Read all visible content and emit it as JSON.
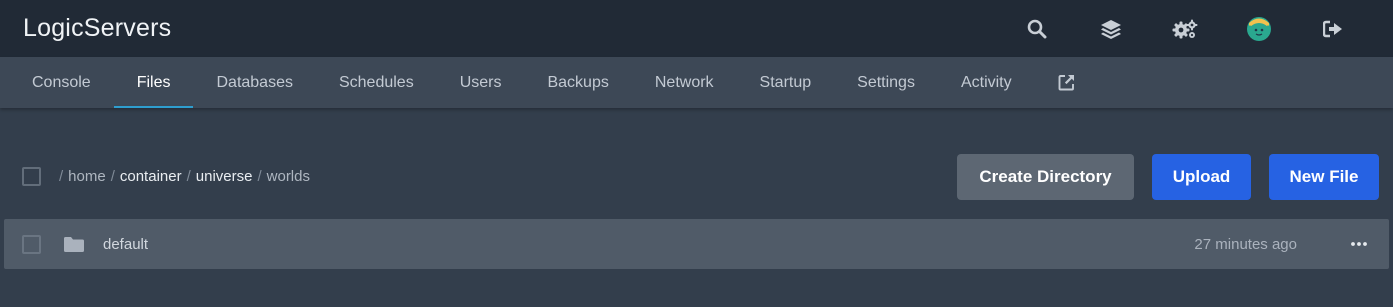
{
  "app": {
    "title": "LogicServers"
  },
  "topbar": {
    "icons": [
      {
        "name": "search-icon"
      },
      {
        "name": "layers-icon"
      },
      {
        "name": "cogs-icon"
      },
      {
        "name": "avatar"
      },
      {
        "name": "sign-out-icon"
      }
    ]
  },
  "nav": {
    "items": [
      {
        "label": "Console"
      },
      {
        "label": "Files",
        "active": true
      },
      {
        "label": "Databases"
      },
      {
        "label": "Schedules"
      },
      {
        "label": "Users"
      },
      {
        "label": "Backups"
      },
      {
        "label": "Network"
      },
      {
        "label": "Startup"
      },
      {
        "label": "Settings"
      },
      {
        "label": "Activity"
      }
    ],
    "external_icon": "external-link-icon"
  },
  "breadcrumb": {
    "separator": "/",
    "segments": [
      "home",
      "container",
      "universe",
      "worlds"
    ]
  },
  "actions": {
    "create_directory": "Create Directory",
    "upload": "Upload",
    "new_file": "New File"
  },
  "files": [
    {
      "name": "default",
      "type": "folder",
      "modified": "27 minutes ago"
    }
  ],
  "colors": {
    "topbar": "#212a36",
    "navbar": "#3d4856",
    "page": "#333e4c",
    "accent": "#2e9ecf",
    "primary_button": "#2662e3",
    "secondary_button": "#5d6773"
  }
}
